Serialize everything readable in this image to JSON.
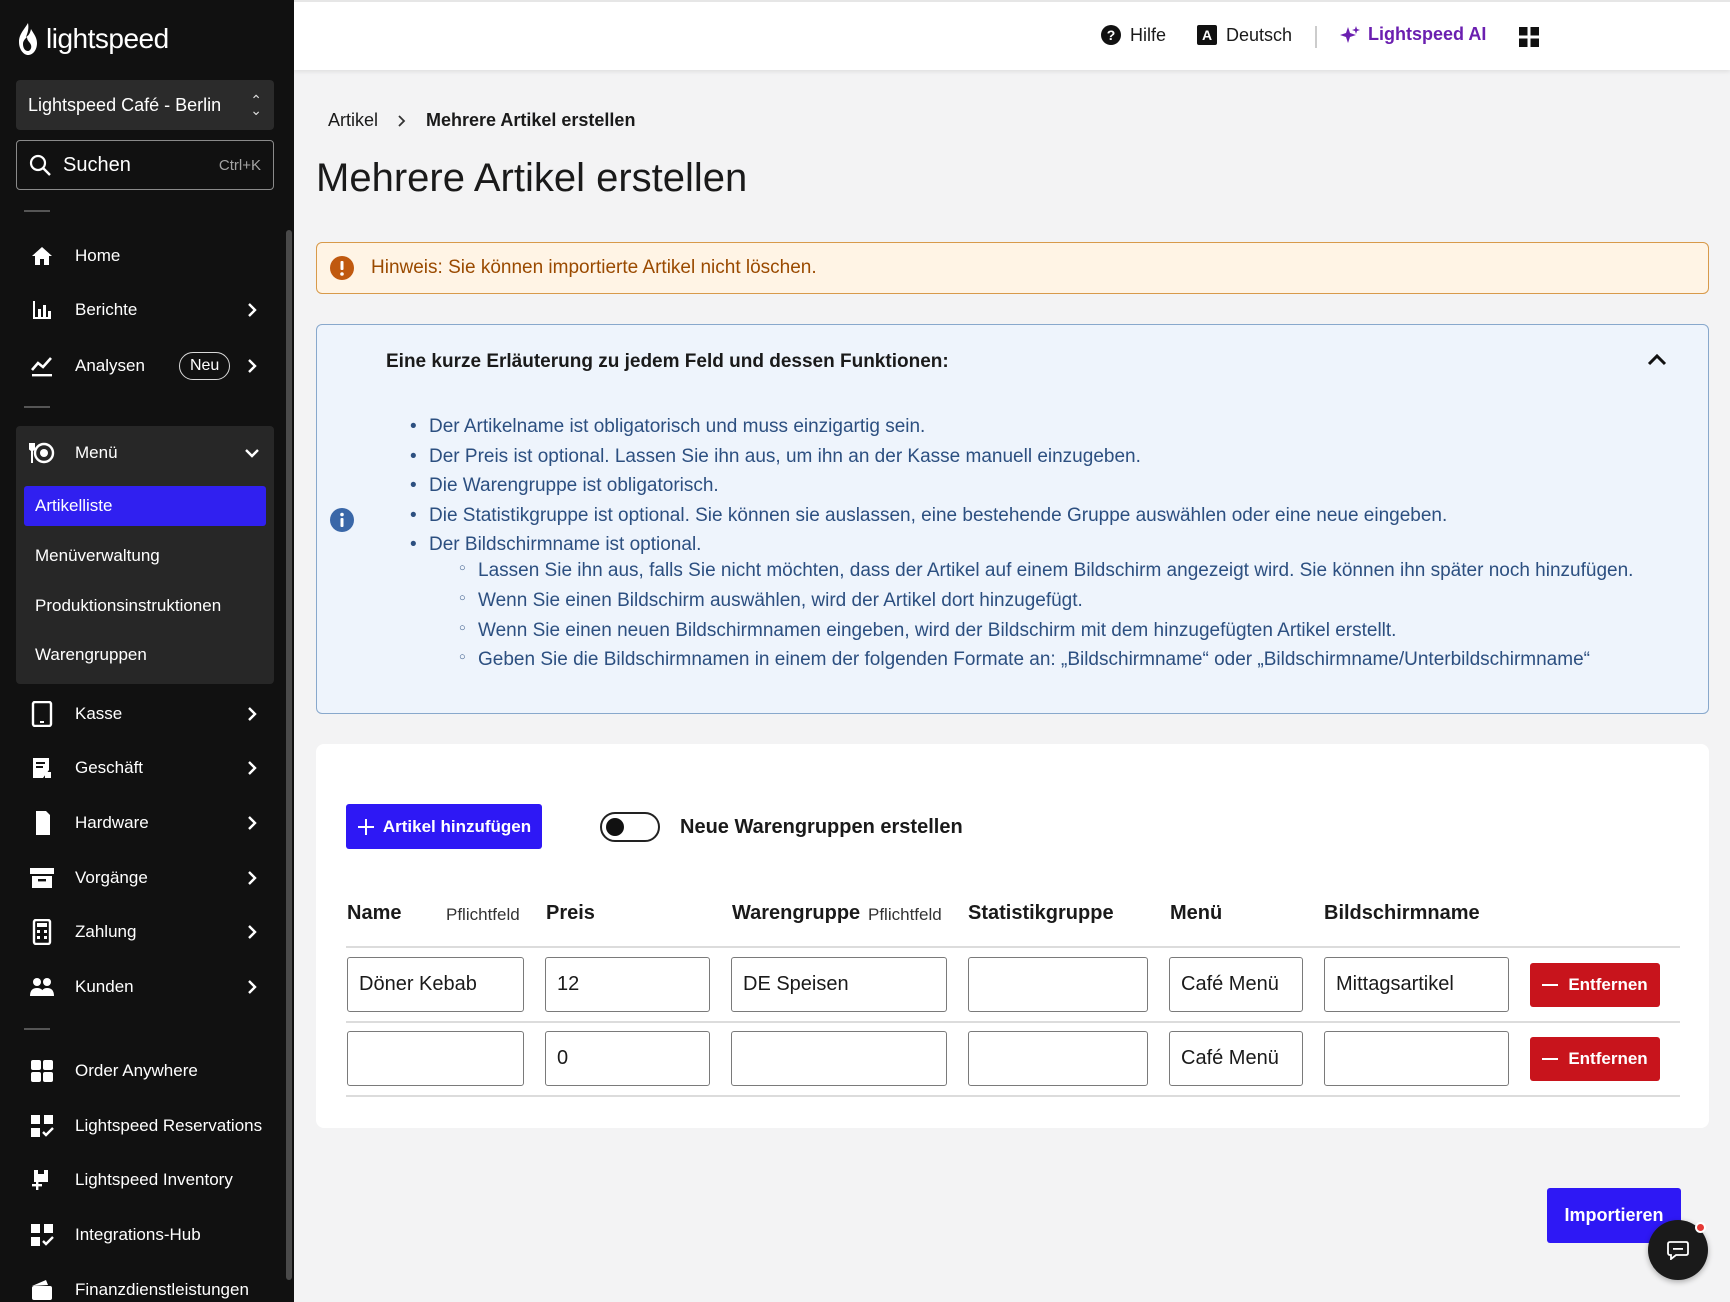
{
  "brand": {
    "name": "lightspeed"
  },
  "sidebar": {
    "location": "Lightspeed Café - Berlin",
    "search": {
      "label": "Suchen",
      "shortcut": "Ctrl+K"
    },
    "items": [
      {
        "label": "Home"
      },
      {
        "label": "Berichte"
      },
      {
        "label": "Analysen",
        "badge": "Neu"
      },
      {
        "label": "Menü"
      },
      {
        "label": "Kasse"
      },
      {
        "label": "Geschäft"
      },
      {
        "label": "Hardware"
      },
      {
        "label": "Vorgänge"
      },
      {
        "label": "Zahlung"
      },
      {
        "label": "Kunden"
      },
      {
        "label": "Order Anywhere"
      },
      {
        "label": "Lightspeed Reservations"
      },
      {
        "label": "Lightspeed Inventory"
      },
      {
        "label": "Integrations-Hub"
      },
      {
        "label": "Finanzdienstleistungen"
      }
    ],
    "menu_sub": [
      {
        "label": "Artikelliste",
        "active": true
      },
      {
        "label": "Menüverwaltung"
      },
      {
        "label": "Produktionsinstruktionen"
      },
      {
        "label": "Warengruppen"
      }
    ]
  },
  "topbar": {
    "help": "Hilfe",
    "language": "Deutsch",
    "ai": "Lightspeed AI"
  },
  "breadcrumb": {
    "parent": "Artikel",
    "current": "Mehrere Artikel erstellen"
  },
  "page_title": "Mehrere Artikel erstellen",
  "warning": "Hinweis: Sie können importierte Artikel nicht löschen.",
  "info": {
    "heading": "Eine kurze Erläuterung zu jedem Feld und dessen Funktionen:",
    "bullets": [
      "Der Artikelname ist obligatorisch und muss einzigartig sein.",
      "Der Preis ist optional. Lassen Sie ihn aus, um ihn an der Kasse manuell einzugeben.",
      "Die Warengruppe ist obligatorisch.",
      "Die Statistikgruppe ist optional. Sie können sie auslassen, eine bestehende Gruppe auswählen oder eine neue eingeben.",
      "Der Bildschirmname ist optional."
    ],
    "sub_bullets": [
      "Lassen Sie ihn aus, falls Sie nicht möchten, dass der Artikel auf einem Bildschirm angezeigt wird. Sie können ihn später noch hinzufügen.",
      "Wenn Sie einen Bildschirm auswählen, wird der Artikel dort hinzugefügt.",
      "Wenn Sie einen neuen Bildschirmnamen eingeben, wird der Bildschirm mit dem hinzugefügten Artikel erstellt.",
      "Geben Sie die Bildschirmnamen in einem der folgenden Formate an: „Bildschirmname“ oder „Bildschirmname/Unterbildschirmname“"
    ]
  },
  "form": {
    "add_button": "Artikel hinzufügen",
    "toggle_label": "Neue Warengruppen erstellen",
    "toggle_on": false,
    "columns": {
      "name": "Name",
      "required": "Pflichtfeld",
      "price": "Preis",
      "group": "Warengruppe",
      "stats": "Statistikgruppe",
      "menu": "Menü",
      "screen": "Bildschirmname"
    },
    "remove_label": "Entfernen",
    "rows": [
      {
        "name": "Döner Kebab",
        "price": "12",
        "group": "DE Speisen",
        "stats": "",
        "menu": "Café Menü",
        "screen": "Mittagsartikel"
      },
      {
        "name": "",
        "price": "0",
        "group": "",
        "stats": "",
        "menu": "Café Menü",
        "screen": ""
      }
    ]
  },
  "import_button": "Importieren",
  "colors": {
    "accent": "#2e18f5",
    "danger": "#c8141c",
    "warning_text": "#9a4a00",
    "info_text": "#2c4f80",
    "ai": "#6b1fb0"
  }
}
